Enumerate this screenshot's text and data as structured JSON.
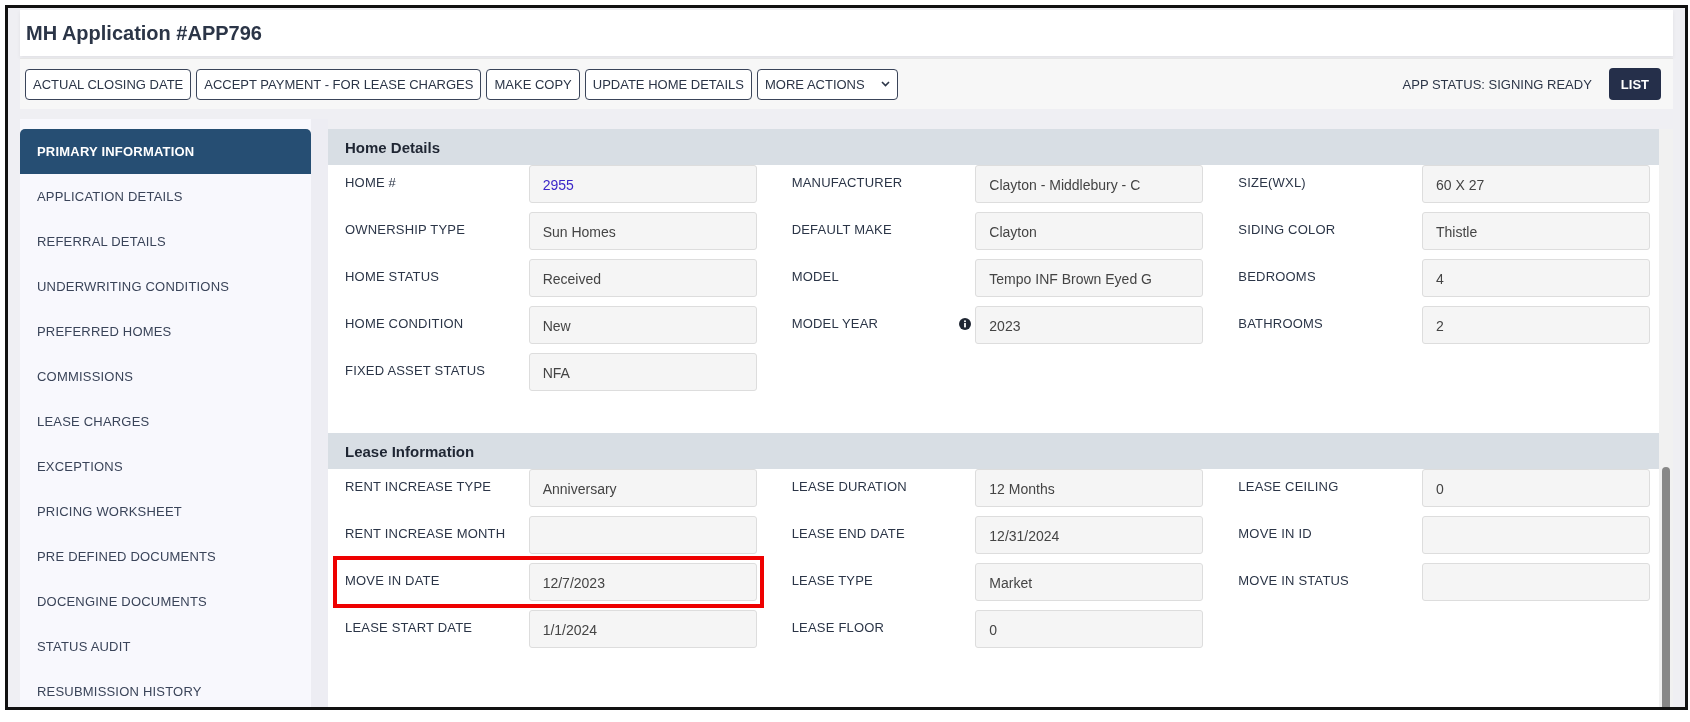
{
  "title": "MH Application #APP796",
  "toolbar": {
    "buttons": [
      {
        "label": "ACTUAL CLOSING DATE",
        "kind": "plain"
      },
      {
        "label": "ACCEPT PAYMENT - FOR LEASE CHARGES",
        "kind": "plain"
      },
      {
        "label": "MAKE COPY",
        "kind": "plain"
      },
      {
        "label": "UPDATE HOME DETAILS",
        "kind": "plain"
      },
      {
        "label": "MORE ACTIONS",
        "kind": "dropdown"
      }
    ],
    "status": "APP STATUS: SIGNING READY",
    "list_button": "LIST"
  },
  "sidebar": {
    "items": [
      {
        "label": "PRIMARY INFORMATION",
        "selected": true
      },
      {
        "label": "APPLICATION DETAILS",
        "selected": false
      },
      {
        "label": "REFERRAL DETAILS",
        "selected": false
      },
      {
        "label": "UNDERWRITING CONDITIONS",
        "selected": false
      },
      {
        "label": "PREFERRED HOMES",
        "selected": false
      },
      {
        "label": "COMMISSIONS",
        "selected": false
      },
      {
        "label": "LEASE CHARGES",
        "selected": false
      },
      {
        "label": "EXCEPTIONS",
        "selected": false
      },
      {
        "label": "PRICING WORKSHEET",
        "selected": false
      },
      {
        "label": "PRE DEFINED DOCUMENTS",
        "selected": false
      },
      {
        "label": "DOCENGINE DOCUMENTS",
        "selected": false
      },
      {
        "label": "STATUS AUDIT",
        "selected": false
      },
      {
        "label": "RESUBMISSION HISTORY",
        "selected": false
      }
    ]
  },
  "sections": [
    {
      "title": "Home Details",
      "rows": [
        [
          {
            "label": "HOME #",
            "value": "2955",
            "kind": "link"
          },
          {
            "label": "MANUFACTURER",
            "value": "Clayton - Middlebury - C",
            "kind": "text"
          },
          {
            "label": "SIZE(WXL)",
            "value": "60 X 27",
            "kind": "text"
          }
        ],
        [
          {
            "label": "OWNERSHIP TYPE",
            "value": "Sun Homes",
            "kind": "text"
          },
          {
            "label": "DEFAULT MAKE",
            "value": "Clayton",
            "kind": "text"
          },
          {
            "label": "SIDING COLOR",
            "value": "Thistle",
            "kind": "text"
          }
        ],
        [
          {
            "label": "HOME STATUS",
            "value": "Received",
            "kind": "text"
          },
          {
            "label": "MODEL",
            "value": "Tempo INF Brown Eyed G",
            "kind": "text"
          },
          {
            "label": "BEDROOMS",
            "value": "4",
            "kind": "text"
          }
        ],
        [
          {
            "label": "HOME CONDITION",
            "value": "New",
            "kind": "text"
          },
          {
            "label": "MODEL YEAR",
            "value": "2023",
            "kind": "text",
            "info": true
          },
          {
            "label": "BATHROOMS",
            "value": "2",
            "kind": "text"
          }
        ],
        [
          {
            "label": "FIXED ASSET STATUS",
            "value": "NFA",
            "kind": "text"
          }
        ]
      ]
    },
    {
      "title": "Lease Information",
      "rows": [
        [
          {
            "label": "RENT INCREASE TYPE",
            "value": "Anniversary",
            "kind": "text"
          },
          {
            "label": "LEASE DURATION",
            "value": "12 Months",
            "kind": "text"
          },
          {
            "label": "LEASE CEILING",
            "value": "0",
            "kind": "text"
          }
        ],
        [
          {
            "label": "RENT INCREASE MONTH",
            "kind": "text"
          },
          {
            "label": "LEASE END DATE",
            "value": "12/31/2024",
            "kind": "text"
          },
          {
            "label": "MOVE IN ID",
            "kind": "text"
          }
        ],
        [
          {
            "label": "MOVE IN DATE",
            "value": "12/7/2023",
            "kind": "text",
            "highlighted": true
          },
          {
            "label": "LEASE TYPE",
            "value": "Market",
            "kind": "text"
          },
          {
            "label": "MOVE IN STATUS",
            "kind": "text"
          }
        ],
        [
          {
            "label": "LEASE START DATE",
            "value": "1/1/2024",
            "kind": "text"
          },
          {
            "label": "LEASE FLOOR",
            "value": "0",
            "kind": "text"
          }
        ]
      ]
    }
  ]
}
